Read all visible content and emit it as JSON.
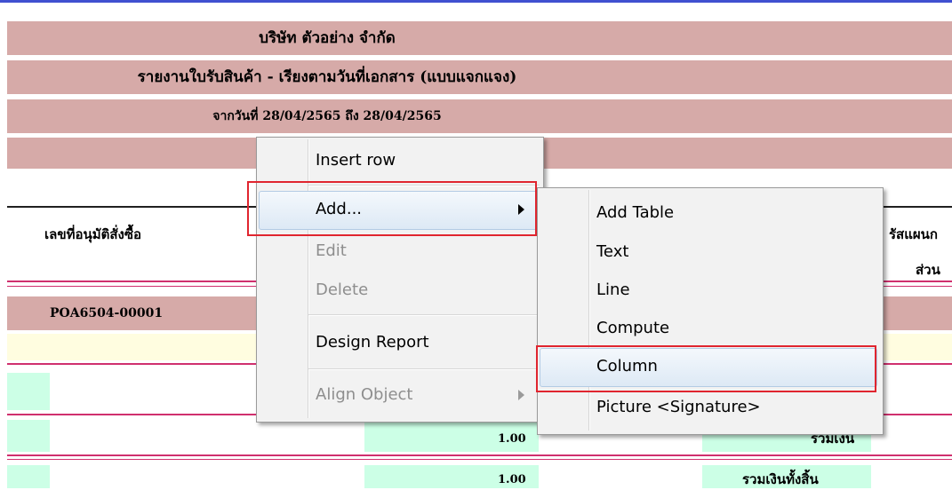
{
  "report": {
    "company": "บริษัท ตัวอย่าง จำกัด",
    "title": "รายงานใบรับสินค้า - เรียงตามวันที่เอกสาร (แบบแจกแจง)",
    "date_range": "จากวันที่ 28/04/2565 ถึง 28/04/2565"
  },
  "table": {
    "header_col1": "เลขที่อนุมัติสั่งซื้อ",
    "header_right_1": "รัสแผนก",
    "header_right_2": "ส่วน",
    "row_doc_no": "POA6504-00001",
    "total_amount_1": "1.00",
    "total_label_1": "รวมเงิน",
    "total_amount_2": "1.00",
    "total_label_2": "รวมเงินทั้งสิ้น"
  },
  "context_menu": {
    "items": [
      {
        "label": "Insert row",
        "enabled": true
      },
      {
        "label": "Add...",
        "enabled": true,
        "submenu": true,
        "highlighted": true
      },
      {
        "label": "Edit",
        "enabled": false
      },
      {
        "label": "Delete",
        "enabled": false
      },
      {
        "label": "Design Report",
        "enabled": true
      },
      {
        "label": "Align Object",
        "enabled": false,
        "submenu": true
      }
    ]
  },
  "submenu": {
    "items": [
      {
        "label": "Add Table"
      },
      {
        "label": "Text"
      },
      {
        "label": "Line"
      },
      {
        "label": "Compute"
      },
      {
        "label": "Column",
        "highlighted": true
      },
      {
        "label": "Picture <Signature>"
      }
    ]
  },
  "colors": {
    "band": "#d6aaa8",
    "accent_line": "#d0306e",
    "highlight_box": "#e0252f",
    "cell_green": "#ccffe6",
    "row_yellow": "#fffde0"
  }
}
